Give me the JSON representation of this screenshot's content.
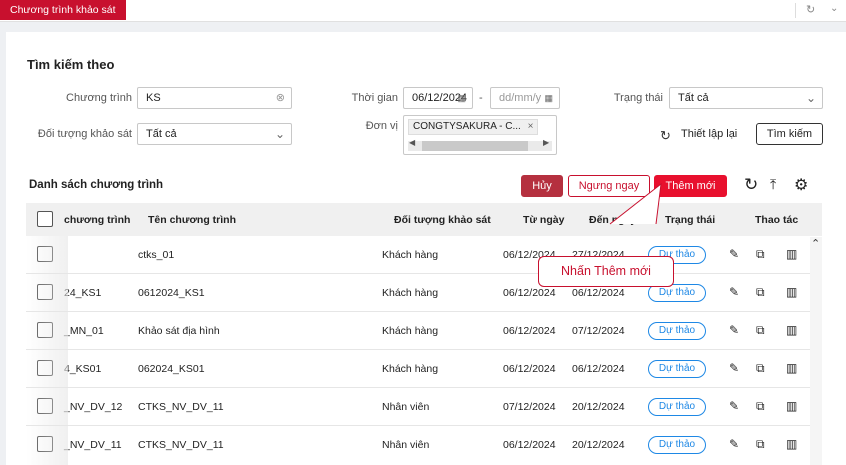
{
  "tab": {
    "label": "Chương trình khảo sát"
  },
  "search": {
    "title": "Tìm kiếm theo",
    "program_label": "Chương trình",
    "program_value": "KS",
    "time_label": "Thời gian",
    "date_from": "06/12/2024",
    "date_to_placeholder": "dd/mm/y",
    "date_sep": "-",
    "status_label": "Trạng thái",
    "status_value": "Tất cả",
    "target_label": "Đối tượng khảo sát",
    "target_value": "Tất cả",
    "unit_label": "Đơn vị",
    "unit_tag": "CONGTYSAKURA - C...",
    "reset_label": "Thiết lập lại",
    "search_button": "Tìm kiếm"
  },
  "list": {
    "title": "Danh sách chương trình",
    "cancel_label": "Hủy",
    "stop_label": "Ngưng ngay",
    "add_label": "Thêm mới",
    "tooltip": "Nhấn Thêm mới"
  },
  "table": {
    "headers": [
      "chương trình",
      "Tên chương trình",
      "Đối tượng khảo sát",
      "Từ ngày",
      "Đến ngày",
      "Trạng thái",
      "Thao tác"
    ],
    "rows": [
      {
        "code": "",
        "name": "ctks_01",
        "target": "Khách hàng",
        "from": "06/12/2024",
        "to": "27/12/2024",
        "status": "Dự thảo"
      },
      {
        "code": "24_KS1",
        "name": "0612024_KS1",
        "target": "Khách hàng",
        "from": "06/12/2024",
        "to": "06/12/2024",
        "status": "Dự thảo"
      },
      {
        "code": "_MN_01",
        "name": "Khảo sát địa hình",
        "target": "Khách hàng",
        "from": "06/12/2024",
        "to": "07/12/2024",
        "status": "Dự thảo"
      },
      {
        "code": "4_KS01",
        "name": "062024_KS01",
        "target": "Khách hàng",
        "from": "06/12/2024",
        "to": "06/12/2024",
        "status": "Dự thảo"
      },
      {
        "code": "_NV_DV_12",
        "name": "CTKS_NV_DV_11",
        "target": "Nhân viên",
        "from": "07/12/2024",
        "to": "20/12/2024",
        "status": "Dự thảo"
      },
      {
        "code": "_NV_DV_11",
        "name": "CTKS_NV_DV_11",
        "target": "Nhân viên",
        "from": "06/12/2024",
        "to": "20/12/2024",
        "status": "Dự thảo"
      }
    ]
  },
  "colors": {
    "brand": "#c8102e",
    "status": "#1e88e5"
  },
  "icons": [
    "refresh-icon",
    "chevron-down-icon",
    "edit-icon",
    "copy-icon",
    "chart-icon",
    "settings-icon",
    "export-icon"
  ]
}
